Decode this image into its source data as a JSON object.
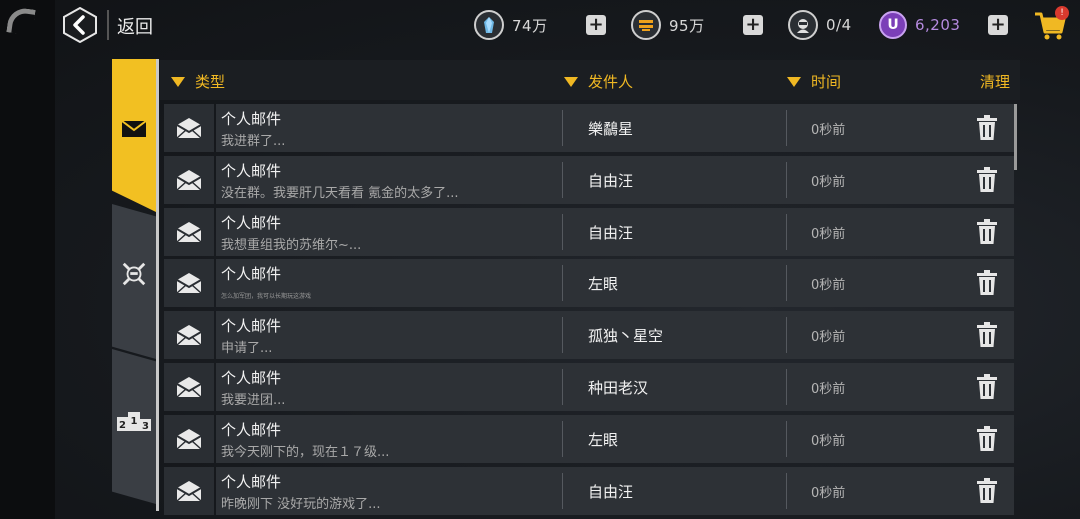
{
  "topbar": {
    "back_label": "返回",
    "resources": [
      {
        "icon": "crystal-icon",
        "value": "74万"
      },
      {
        "icon": "gold-icon",
        "value": "95万"
      },
      {
        "icon": "pilot-icon",
        "value": "0/4"
      },
      {
        "icon": "u-coin-icon",
        "value": "6,203",
        "symbol": "U"
      }
    ],
    "plus_label": "+",
    "cart_badge": "!"
  },
  "tabs": [
    {
      "name": "mail",
      "icon": "envelope-icon",
      "active": true
    },
    {
      "name": "battle",
      "icon": "crossed-swords-icon",
      "active": false
    },
    {
      "name": "ranking",
      "icon": "podium-icon",
      "active": false,
      "digits": [
        "2",
        "1",
        "3"
      ]
    }
  ],
  "list_header": {
    "type_label": "类型",
    "sender_label": "发件人",
    "time_label": "时间",
    "clear_label": "清理"
  },
  "mails": [
    {
      "title": "个人邮件",
      "preview": "我进群了...",
      "sender": "樂鷸星",
      "time": "0秒前"
    },
    {
      "title": "个人邮件",
      "preview": "没在群。我要肝几天看看 氪金的太多了...",
      "sender": "自由汪",
      "time": "0秒前"
    },
    {
      "title": "个人邮件",
      "preview": "我想重组我的苏维尔~...",
      "sender": "自由汪",
      "time": "0秒前"
    },
    {
      "title": "个人邮件",
      "preview": "怎么加军团，我可以长期玩这游戏",
      "sender": "左眼",
      "time": "0秒前"
    },
    {
      "title": "个人邮件",
      "preview": "申请了...",
      "sender": "孤独丶星空",
      "time": "0秒前"
    },
    {
      "title": "个人邮件",
      "preview": "我要进团...",
      "sender": "种田老汉",
      "time": "0秒前"
    },
    {
      "title": "个人邮件",
      "preview": "我今天刚下的，现在１７级...",
      "sender": "左眼",
      "time": "0秒前"
    },
    {
      "title": "个人邮件",
      "preview": "昨晚刚下 没好玩的游戏了...",
      "sender": "自由汪",
      "time": "0秒前"
    }
  ],
  "colors": {
    "accent": "#f2c022",
    "row_bg": "#2d3136",
    "background": "#16191d",
    "u_coin": "#7b3fb8"
  }
}
